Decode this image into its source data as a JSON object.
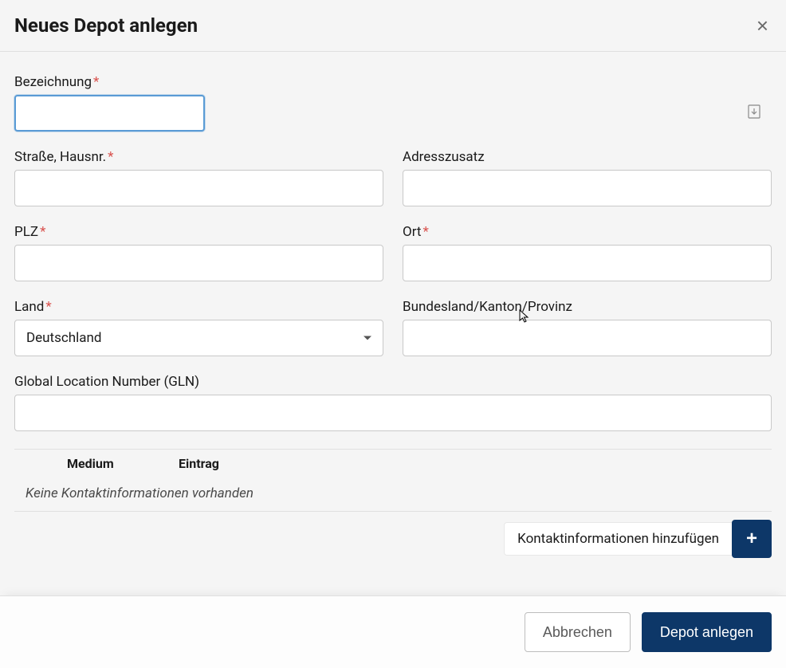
{
  "modal": {
    "title": "Neues Depot anlegen",
    "close_label": "×"
  },
  "form": {
    "bezeichnung": {
      "label": "Bezeichnung",
      "required": true,
      "value": ""
    },
    "strasse": {
      "label": "Straße, Hausnr.",
      "required": true,
      "value": ""
    },
    "adresszusatz": {
      "label": "Adresszusatz",
      "required": false,
      "value": ""
    },
    "plz": {
      "label": "PLZ",
      "required": true,
      "value": ""
    },
    "ort": {
      "label": "Ort",
      "required": true,
      "value": ""
    },
    "land": {
      "label": "Land",
      "required": true,
      "selected": "Deutschland"
    },
    "bundesland": {
      "label": "Bundesland/Kanton/Provinz",
      "required": false,
      "value": ""
    },
    "gln": {
      "label": "Global Location Number (GLN)",
      "required": false,
      "value": ""
    }
  },
  "contact": {
    "columns": {
      "medium": "Medium",
      "entry": "Eintrag"
    },
    "empty_message": "Keine Kontaktinformationen vorhanden",
    "add_label": "Kontaktinformationen hinzufügen"
  },
  "footer": {
    "cancel": "Abbrechen",
    "submit": "Depot anlegen"
  },
  "required_marker": "*"
}
